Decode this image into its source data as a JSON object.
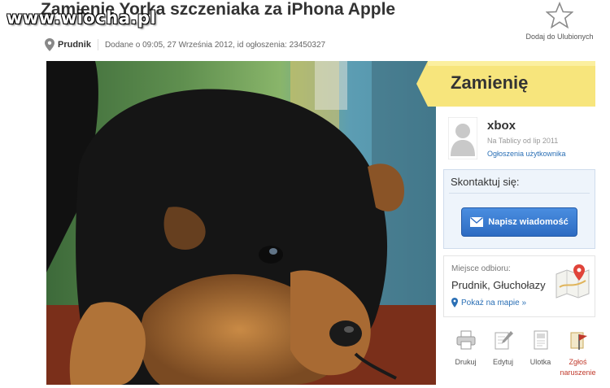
{
  "watermark": "www.wiocha.pl",
  "title": "Zamienię Yorka szczeniaka za iPhona Apple",
  "favorite_label": "Dodaj do Ulubionych",
  "location_city": "Prudnik",
  "added_info": "Dodane o 09:05, 27 Września 2012, id ogłoszenia: 23450327",
  "banner_label": "Zamienię",
  "user": {
    "name": "xbox",
    "since": "Na Tablicy od lip 2011",
    "listings_link": "Ogłoszenia użytkownika"
  },
  "contact": {
    "header": "Skontaktuj się:",
    "button_label": "Napisz wiadomość"
  },
  "pickup": {
    "label": "Miejsce odbioru:",
    "value": "Prudnik, Głuchołazy",
    "map_link": "Pokaż na mapie »"
  },
  "actions": {
    "print": "Drukuj",
    "edit": "Edytuj",
    "flyer": "Ulotka",
    "report_line1": "Zgłoś",
    "report_line2": "naruszenie"
  },
  "colors": {
    "banner": "#f7e57c",
    "button": "#3a7bd5",
    "link": "#2a6fb5",
    "report": "#c0392b"
  }
}
